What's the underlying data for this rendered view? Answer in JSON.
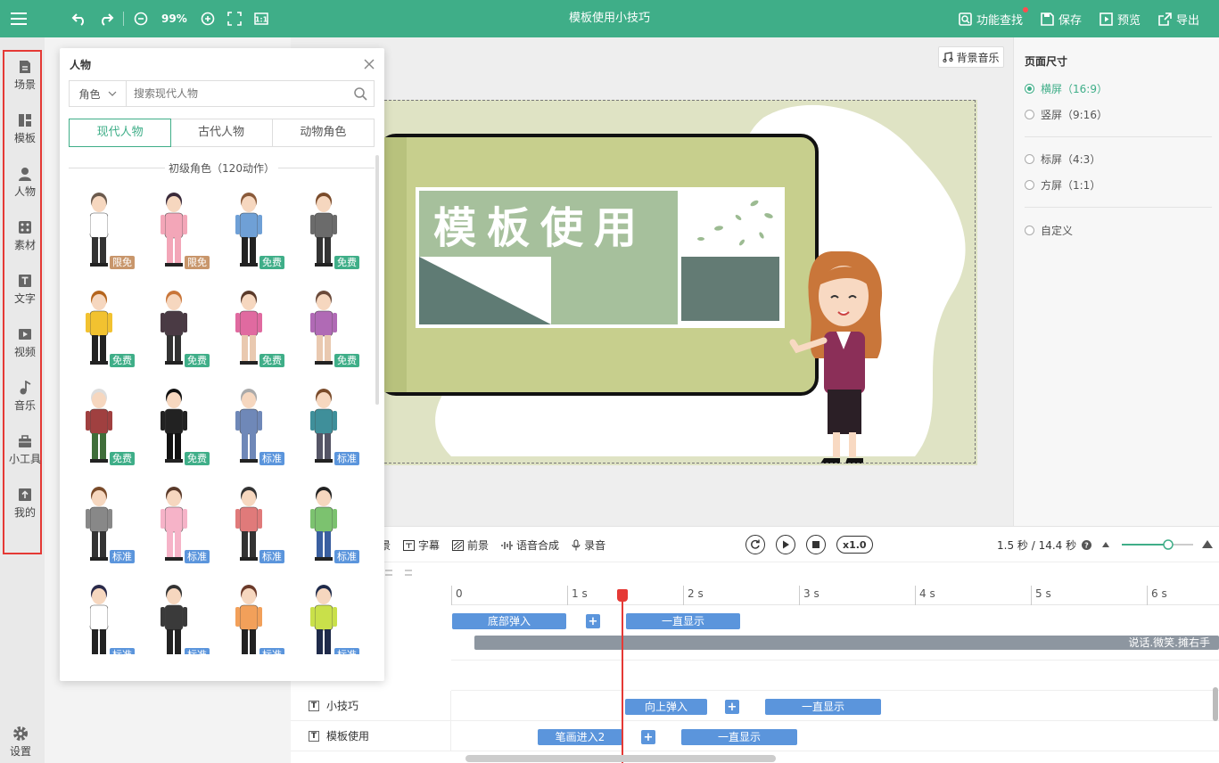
{
  "topbar": {
    "zoom": "99%",
    "title": "模板使用小技巧",
    "actions": [
      {
        "label": "功能查找",
        "icon": "search-feature-icon"
      },
      {
        "label": "保存",
        "icon": "save-icon"
      },
      {
        "label": "预览",
        "icon": "preview-icon"
      },
      {
        "label": "导出",
        "icon": "export-icon"
      }
    ]
  },
  "sidebar": {
    "items": [
      {
        "label": "场景",
        "icon": "scene-icon"
      },
      {
        "label": "模板",
        "icon": "template-icon"
      },
      {
        "label": "人物",
        "icon": "person-icon"
      },
      {
        "label": "素材",
        "icon": "material-icon"
      },
      {
        "label": "文字",
        "icon": "text-icon"
      },
      {
        "label": "视频",
        "icon": "video-icon"
      },
      {
        "label": "音乐",
        "icon": "music-icon"
      },
      {
        "label": "小工具",
        "icon": "toolbox-icon"
      },
      {
        "label": "我的",
        "icon": "upload-icon"
      }
    ],
    "settings_label": "设置"
  },
  "panel": {
    "title": "人物",
    "search_select": "角色",
    "search_placeholder": "搜索现代人物",
    "tabs": [
      "现代人物",
      "古代人物",
      "动物角色"
    ],
    "active_tab": 0,
    "section_title": "初级角色（120动作）",
    "characters": [
      {
        "badge": "限免",
        "color": "#c8966b"
      },
      {
        "badge": "限免",
        "color": "#c8966b"
      },
      {
        "badge": "免费",
        "color": "#3fae88"
      },
      {
        "badge": "免费",
        "color": "#3fae88"
      },
      {
        "badge": "免费",
        "color": "#3fae88"
      },
      {
        "badge": "免费",
        "color": "#3fae88"
      },
      {
        "badge": "免费",
        "color": "#3fae88"
      },
      {
        "badge": "免费",
        "color": "#3fae88"
      },
      {
        "badge": "免费",
        "color": "#3fae88"
      },
      {
        "badge": "免费",
        "color": "#3fae88"
      },
      {
        "badge": "标准",
        "color": "#5b95dc"
      },
      {
        "badge": "标准",
        "color": "#5b95dc"
      },
      {
        "badge": "标准",
        "color": "#5b95dc"
      },
      {
        "badge": "标准",
        "color": "#5b95dc"
      },
      {
        "badge": "标准",
        "color": "#5b95dc"
      },
      {
        "badge": "标准",
        "color": "#5b95dc"
      },
      {
        "badge": "标准",
        "color": "#5b95dc"
      },
      {
        "badge": "标准",
        "color": "#5b95dc"
      },
      {
        "badge": "标准",
        "color": "#5b95dc"
      },
      {
        "badge": "标准",
        "color": "#5b95dc"
      }
    ]
  },
  "canvas": {
    "bgm_label": "背景音乐",
    "slide_title": "模板使用"
  },
  "page_size": {
    "title": "页面尺寸",
    "options": [
      "横屏（16:9）",
      "竖屏（9:16）",
      "标屏（4:3）",
      "方屏（1:1）",
      "自定义"
    ],
    "selected": 0
  },
  "timeline": {
    "tools": [
      "景",
      "字幕",
      "前景",
      "语音合成",
      "录音"
    ],
    "speed": "x1.0",
    "time": "1.5 秒 / 14.4 秒",
    "ruler": [
      "0",
      "1 s",
      "2 s",
      "3 s",
      "4 s",
      "5 s",
      "6 s"
    ],
    "tracks": [
      {
        "label": "",
        "blocks": [
          "底部弹入",
          "一直显示"
        ],
        "longbar": "说话.微笑.摊右手"
      },
      {
        "label": "小技巧",
        "blocks": [
          "向上弹入",
          "一直显示"
        ]
      },
      {
        "label": "模板使用",
        "blocks": [
          "笔画进入2",
          "一直显示"
        ]
      }
    ]
  }
}
